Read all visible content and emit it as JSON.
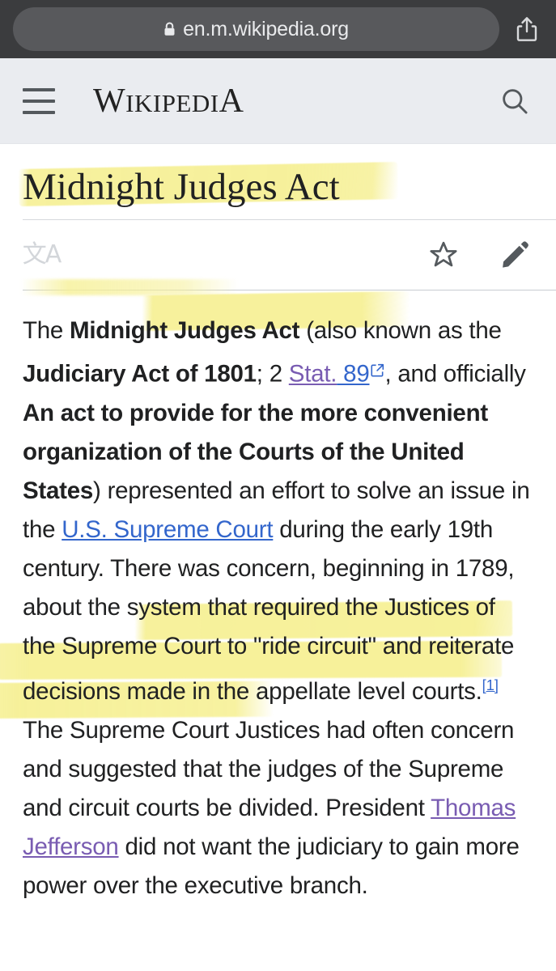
{
  "browser": {
    "url": "en.m.wikipedia.org",
    "lock_icon": "lock-icon",
    "share_icon": "share-icon"
  },
  "wiki_header": {
    "menu_icon": "hamburger-menu-icon",
    "wordmark_w": "W",
    "wordmark_ikipedi": "IKIPEDI",
    "wordmark_a": "A",
    "search_icon": "search-icon"
  },
  "article": {
    "title": "Midnight Judges Act",
    "actions": {
      "language_glyph": "文A",
      "language_icon": "language-icon",
      "watch_icon": "star-icon",
      "edit_icon": "pencil-icon"
    },
    "lead": {
      "s1": "The ",
      "b1": "Midnight Judges Act",
      "s2": " (also known as the ",
      "b2": "Judiciary Act of 1801",
      "s3": "; 2 ",
      "link_stat": "Stat.",
      "link_89": " 89",
      "s4": ", and officially ",
      "b3": "An act to provide for the more convenient organization of the Courts of the United States",
      "s5": ") represented an effort to solve an issue in the ",
      "link_scotus": "U.S. Supreme Court",
      "s6": " during the early 19th century. There was concern, beginning in 1789, about the system that required the Justices of the Supreme Court to \"ride circuit\" and reiterate decisions made in the appellate level courts.",
      "cite1": "[1]",
      "s7": " The Supreme Court Justices had often concern and suggested that the judges of the Supreme and circuit courts be divided. President ",
      "link_jefferson": "Thomas Jefferson",
      "s8": " did not want the judiciary to gain more power over the executive branch."
    }
  },
  "colors": {
    "link": "#3366cc",
    "visited_link": "#795cb2",
    "highlight": "#f6f096",
    "chrome_bg": "#3b3c3e",
    "header_bg": "#eaecf0",
    "text": "#202122"
  }
}
